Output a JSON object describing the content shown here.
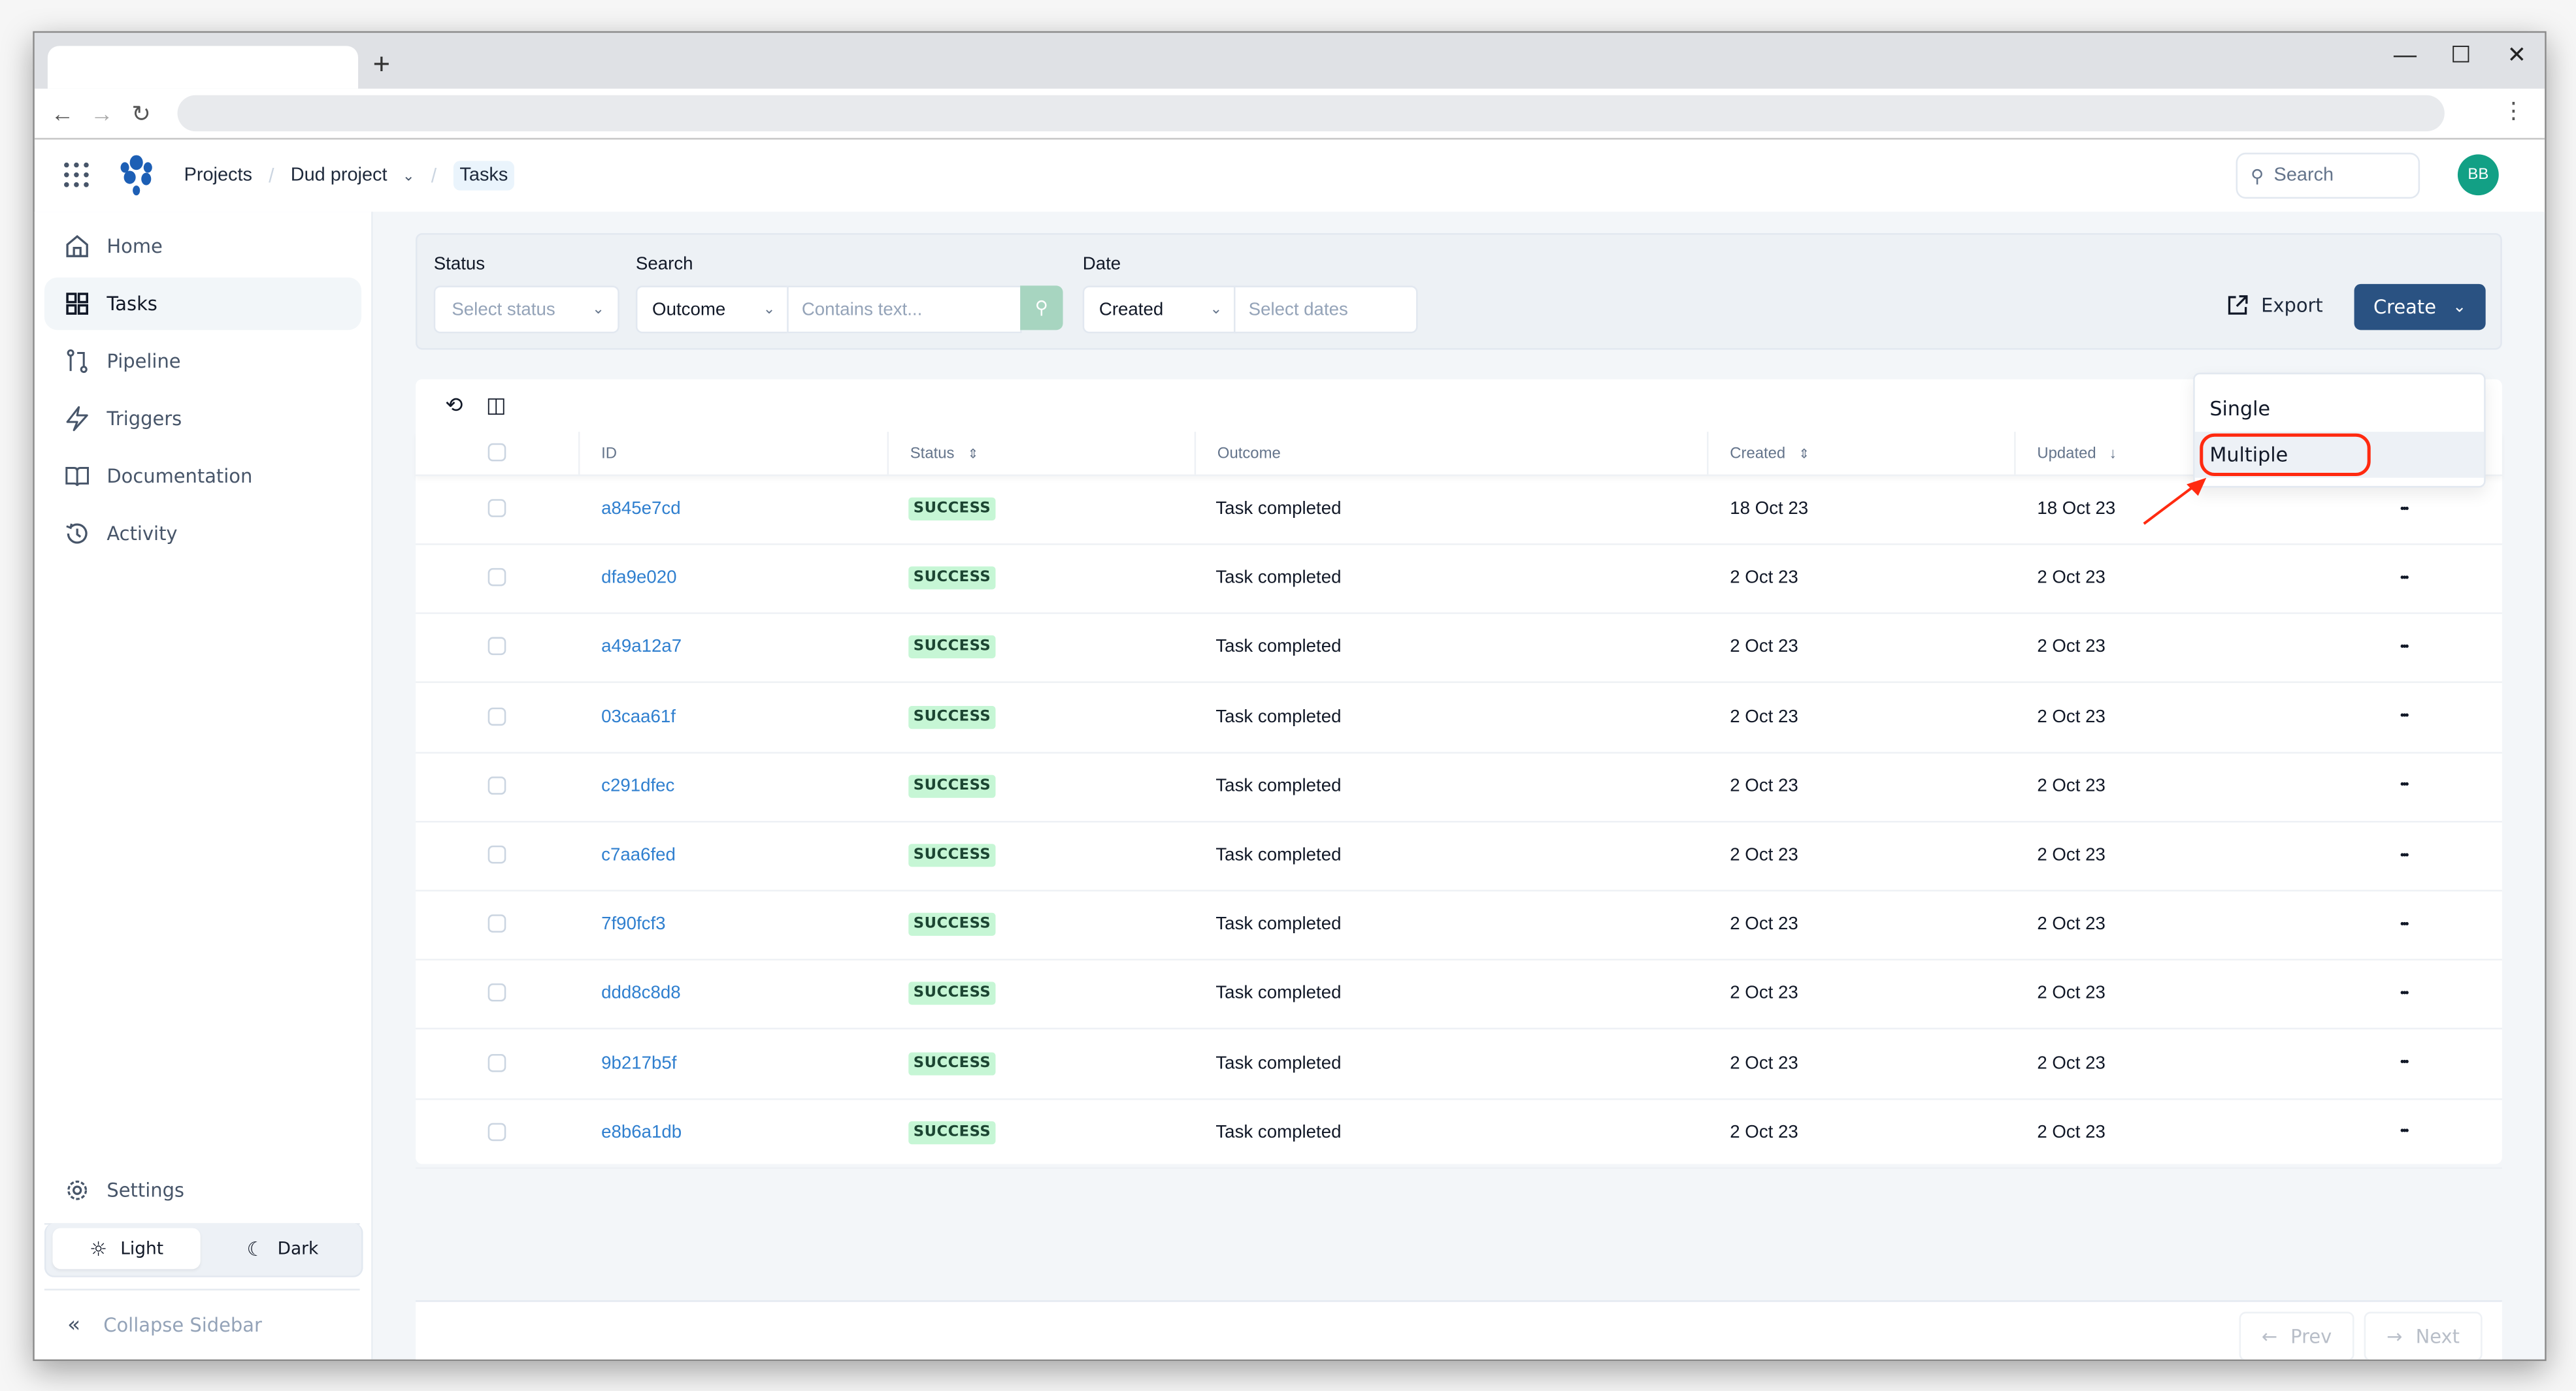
{
  "browser": {
    "new_tab_label": "+",
    "window_controls": {
      "minimize": "—",
      "maximize": "☐",
      "close": "✕"
    },
    "nav": {
      "back": "←",
      "forward": "→",
      "reload": "↻",
      "menu": "⋮"
    }
  },
  "header": {
    "breadcrumb": [
      "Projects",
      "Dud project",
      "Tasks"
    ],
    "breadcrumb_separator": "/",
    "search_placeholder": "Search",
    "avatar_initials": "BB",
    "avatar_color": "#12a085"
  },
  "sidebar": {
    "items": [
      {
        "label": "Home",
        "icon": "home-icon"
      },
      {
        "label": "Tasks",
        "icon": "grid-icon",
        "active": true
      },
      {
        "label": "Pipeline",
        "icon": "git-pull-request-icon"
      },
      {
        "label": "Triggers",
        "icon": "lightning-icon"
      },
      {
        "label": "Documentation",
        "icon": "book-icon"
      },
      {
        "label": "Activity",
        "icon": "history-icon"
      }
    ],
    "settings_label": "Settings",
    "theme": {
      "light_label": "Light",
      "dark_label": "Dark",
      "selected": "Light"
    },
    "collapse_label": "Collapse Sidebar"
  },
  "filters": {
    "status": {
      "label": "Status",
      "placeholder": "Select status"
    },
    "search": {
      "label": "Search",
      "field_value": "Outcome",
      "placeholder": "Contains text..."
    },
    "date": {
      "label": "Date",
      "field_value": "Created",
      "placeholder": "Select dates"
    },
    "export_label": "Export",
    "create_label": "Create",
    "create_menu": {
      "items": [
        "Single",
        "Multiple"
      ],
      "highlighted": "Multiple"
    }
  },
  "colors": {
    "primary": "#2a5282",
    "link": "#2f7fcf",
    "success_bg": "#c6f6d5",
    "success_text": "#1c4532",
    "annotation": "#ff2a10"
  },
  "table": {
    "columns": [
      {
        "label": "ID",
        "sort": ""
      },
      {
        "label": "Status",
        "sort": "⇕"
      },
      {
        "label": "Outcome",
        "sort": ""
      },
      {
        "label": "Created",
        "sort": "⇕"
      },
      {
        "label": "Updated",
        "sort": "↓"
      }
    ],
    "rows": [
      {
        "id": "a845e7cd",
        "status": "SUCCESS",
        "outcome": "Task completed",
        "created": "18 Oct 23",
        "updated": "18 Oct 23"
      },
      {
        "id": "dfa9e020",
        "status": "SUCCESS",
        "outcome": "Task completed",
        "created": "2 Oct 23",
        "updated": "2 Oct 23"
      },
      {
        "id": "a49a12a7",
        "status": "SUCCESS",
        "outcome": "Task completed",
        "created": "2 Oct 23",
        "updated": "2 Oct 23"
      },
      {
        "id": "03caa61f",
        "status": "SUCCESS",
        "outcome": "Task completed",
        "created": "2 Oct 23",
        "updated": "2 Oct 23"
      },
      {
        "id": "c291dfec",
        "status": "SUCCESS",
        "outcome": "Task completed",
        "created": "2 Oct 23",
        "updated": "2 Oct 23"
      },
      {
        "id": "c7aa6fed",
        "status": "SUCCESS",
        "outcome": "Task completed",
        "created": "2 Oct 23",
        "updated": "2 Oct 23"
      },
      {
        "id": "7f90fcf3",
        "status": "SUCCESS",
        "outcome": "Task completed",
        "created": "2 Oct 23",
        "updated": "2 Oct 23"
      },
      {
        "id": "ddd8c8d8",
        "status": "SUCCESS",
        "outcome": "Task completed",
        "created": "2 Oct 23",
        "updated": "2 Oct 23"
      },
      {
        "id": "9b217b5f",
        "status": "SUCCESS",
        "outcome": "Task completed",
        "created": "2 Oct 23",
        "updated": "2 Oct 23"
      },
      {
        "id": "e8b6a1db",
        "status": "SUCCESS",
        "outcome": "Task completed",
        "created": "2 Oct 23",
        "updated": "2 Oct 23"
      }
    ],
    "row_menu_label": "•••"
  },
  "pagination": {
    "prev_label": "Prev",
    "next_label": "Next"
  }
}
